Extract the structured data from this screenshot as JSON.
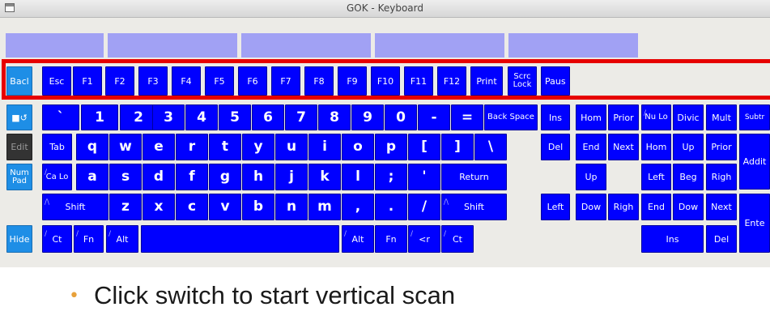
{
  "window": {
    "title": "GOK - Keyboard"
  },
  "function_row": [
    "Bacl",
    "Esc",
    "F1",
    "F2",
    "F3",
    "F4",
    "F5",
    "F6",
    "F7",
    "F8",
    "F9",
    "F10",
    "F11",
    "F12",
    "Print",
    "Scrc Lock",
    "Paus"
  ],
  "row1": {
    "side": "■↺",
    "keys": [
      "`",
      "1",
      "2",
      "3",
      "4",
      "5",
      "6",
      "7",
      "8",
      "9",
      "0",
      "-",
      "="
    ],
    "backspace": "Back Space",
    "nav": [
      "Ins",
      "Hom",
      "Prior"
    ],
    "numpad": [
      "Nu Lo",
      "Divic",
      "Mult",
      "Subtr"
    ]
  },
  "row2": {
    "side": "Edit",
    "tab": "Tab",
    "keys": [
      "q",
      "w",
      "e",
      "r",
      "t",
      "y",
      "u",
      "i",
      "o",
      "p",
      "[",
      "]",
      "\\"
    ],
    "nav": [
      "Del",
      "End",
      "Next"
    ],
    "numpad": [
      "Hom",
      "Up",
      "Prior"
    ],
    "addit": "Addit"
  },
  "row3": {
    "side": "Num Pad",
    "caps": "Ca Lo",
    "keys": [
      "a",
      "s",
      "d",
      "f",
      "g",
      "h",
      "j",
      "k",
      "l",
      ";",
      "'"
    ],
    "return": "Return",
    "nav_up": "Up",
    "numpad": [
      "Left",
      "Beg",
      "Righ"
    ]
  },
  "row4": {
    "shift_left": "Shift",
    "keys": [
      "z",
      "x",
      "c",
      "v",
      "b",
      "n",
      "m",
      ",",
      ".",
      "/"
    ],
    "shift_right": "Shift",
    "nav": [
      "Left",
      "Dow",
      "Righ"
    ],
    "numpad": [
      "End",
      "Dow",
      "Next"
    ],
    "enter": "Ente"
  },
  "row5": {
    "hide": "Hide",
    "left": [
      "Ct",
      "Fn",
      "Alt"
    ],
    "right": [
      "Alt",
      "Fn",
      "<r",
      "Ct"
    ],
    "numpad": [
      "Ins",
      "Del"
    ]
  },
  "modifier_mark": "/",
  "shift_mark": "/\\",
  "slide": {
    "bullet": "Click switch to start vertical scan"
  },
  "colors": {
    "key": "#0000ff",
    "side_key": "#1e8ee6",
    "highlight": "#e60000",
    "tab": "#a1a1f4",
    "bullet": "#e8a13a"
  }
}
